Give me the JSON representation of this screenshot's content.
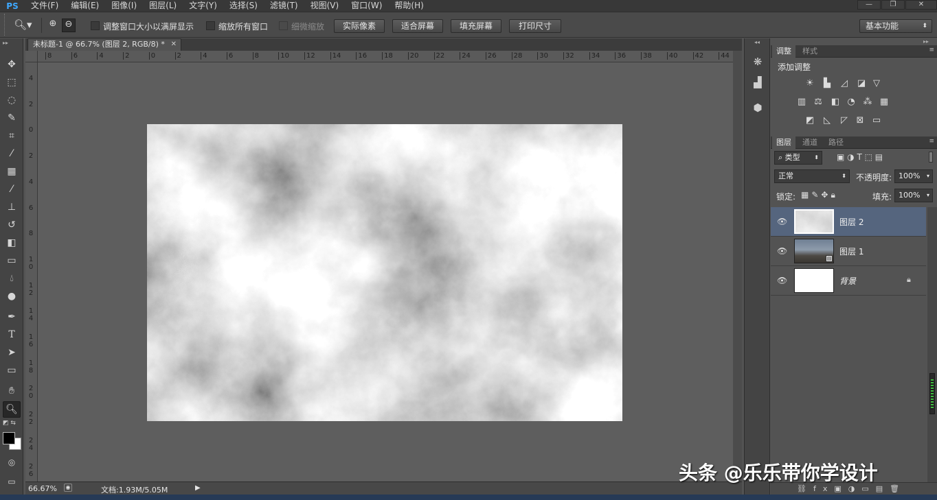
{
  "app": {
    "logo": "PS"
  },
  "menu": [
    "文件(F)",
    "编辑(E)",
    "图像(I)",
    "图层(L)",
    "文字(Y)",
    "选择(S)",
    "滤镜(T)",
    "视图(V)",
    "窗口(W)",
    "帮助(H)"
  ],
  "options_bar": {
    "fit_window_label": "调整窗口大小以满屏显示",
    "zoom_all_label": "缩放所有窗口",
    "scrubby_label": "细微缩放",
    "actual_pixels": "实际像素",
    "fit_screen": "适合屏幕",
    "fill_screen": "填充屏幕",
    "print_size": "打印尺寸",
    "workspace": "基本功能"
  },
  "document": {
    "tab_title": "未标题-1 @ 66.7% (图层 2, RGB/8) *",
    "h_ruler": [
      "8",
      "6",
      "4",
      "2",
      "0",
      "2",
      "4",
      "6",
      "8",
      "10",
      "12",
      "14",
      "16",
      "18",
      "20",
      "22",
      "24",
      "26",
      "28",
      "30",
      "32",
      "34",
      "36",
      "38",
      "40",
      "42",
      "44"
    ],
    "v_ruler": [
      "4",
      "2",
      "0",
      "2",
      "4",
      "6",
      "8",
      "10",
      "12",
      "14",
      "16",
      "18",
      "20",
      "22",
      "24",
      "26"
    ]
  },
  "status": {
    "zoom": "66.67%",
    "doc_info": "文档:1.93M/5.05M"
  },
  "adjustments": {
    "tab_adjust": "调整",
    "tab_styles": "样式",
    "heading": "添加调整"
  },
  "layers_panel": {
    "tab_layers": "图层",
    "tab_channels": "通道",
    "tab_paths": "路径",
    "filter_kind": "类型",
    "blend_mode": "正常",
    "opacity_label": "不透明度:",
    "opacity_value": "100%",
    "lock_label": "锁定:",
    "fill_label": "填充:",
    "fill_value": "100%",
    "layers": [
      {
        "name": "图层 2",
        "selected": true
      },
      {
        "name": "图层 1",
        "selected": false
      },
      {
        "name": "背景",
        "selected": false
      }
    ]
  },
  "watermark": "头条 @乐乐带你学设计"
}
